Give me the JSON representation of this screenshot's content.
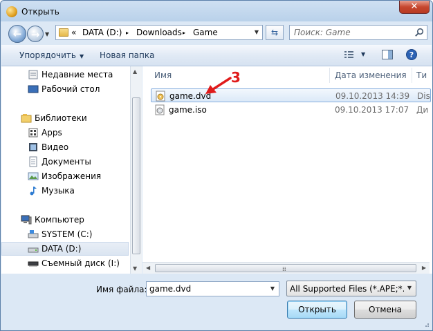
{
  "window": {
    "title": "Открыть",
    "close_glyph": "✕"
  },
  "address": {
    "prefix": "«",
    "crumbs": [
      "DATA (D:)",
      "Downloads",
      "Game"
    ],
    "separators": [
      "▸",
      "▸"
    ]
  },
  "search": {
    "placeholder": "Поиск: Game"
  },
  "toolbar": {
    "organize_label": "Упорядочить",
    "new_folder_label": "Новая папка"
  },
  "nav_pane": {
    "items": [
      {
        "label": "Недавние места",
        "icon": "recent-places-icon"
      },
      {
        "label": "Рабочий стол",
        "icon": "desktop-icon"
      },
      {
        "label": "Библиотеки",
        "icon": "libraries-icon"
      },
      {
        "label": "Apps",
        "icon": "apps-library-icon"
      },
      {
        "label": "Видео",
        "icon": "video-library-icon"
      },
      {
        "label": "Документы",
        "icon": "documents-library-icon"
      },
      {
        "label": "Изображения",
        "icon": "pictures-library-icon"
      },
      {
        "label": "Музыка",
        "icon": "music-library-icon"
      },
      {
        "label": "Компьютер",
        "icon": "computer-icon"
      },
      {
        "label": "SYSTEM (C:)",
        "icon": "system-drive-icon"
      },
      {
        "label": "DATA (D:)",
        "icon": "data-drive-icon",
        "selected": true
      },
      {
        "label": "Съемный диск (I:)",
        "icon": "removable-drive-icon"
      }
    ]
  },
  "file_list": {
    "columns": [
      "Имя",
      "Дата изменения",
      "Ти"
    ],
    "rows": [
      {
        "name": "game.dvd",
        "date": "09.10.2013 14:39",
        "type": "Dis",
        "selected": true,
        "icon": "dvd-file-icon"
      },
      {
        "name": "game.iso",
        "date": "09.10.2013 17:07",
        "type": "Ди",
        "selected": false,
        "icon": "iso-file-icon"
      }
    ]
  },
  "annotation": {
    "step_number": "3",
    "color": "#e01b1b"
  },
  "bottom": {
    "file_name_label": "Имя файла:",
    "file_name_value": "game.dvd",
    "filter_value": "All Supported Files (*.APE;*.BIN",
    "open_label": "Открыть",
    "cancel_label": "Отмена"
  },
  "colors": {
    "accent": "#3c7fb1",
    "title_bg": "#b9d1ea",
    "selection": "#84acdd"
  }
}
